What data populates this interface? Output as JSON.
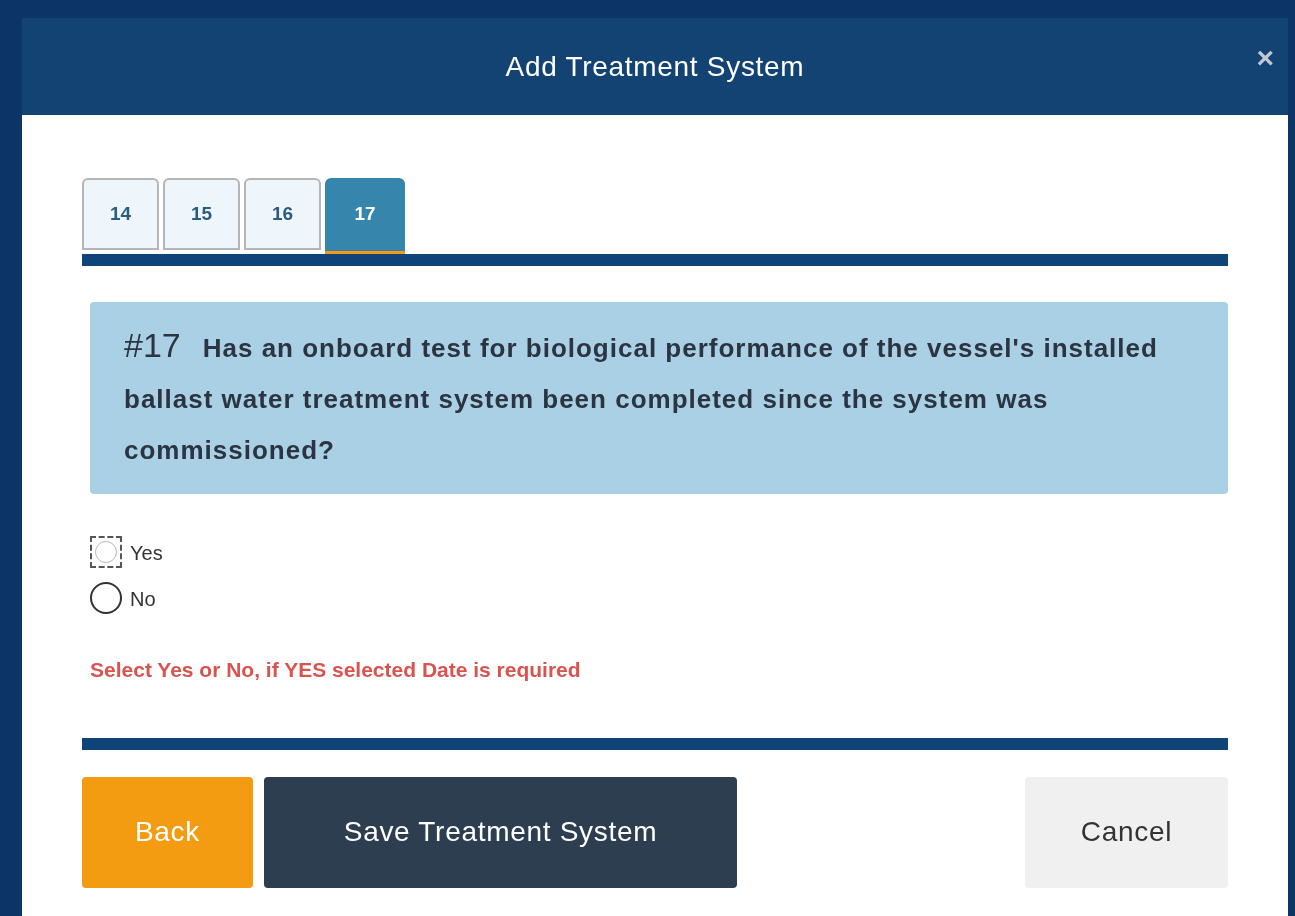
{
  "dialog": {
    "title": "Add Treatment System",
    "close": "×"
  },
  "tabs": [
    {
      "label": "14",
      "selected": false
    },
    {
      "label": "15",
      "selected": false
    },
    {
      "label": "16",
      "selected": false
    },
    {
      "label": "17",
      "selected": true
    }
  ],
  "question": {
    "number": "#17",
    "text": "Has an onboard test for biological performance of the vessel's installed ballast water treatment system been completed since the system was commissioned?"
  },
  "options": [
    {
      "label": "Yes",
      "selected": false,
      "focused": true
    },
    {
      "label": "No",
      "selected": false,
      "focused": false
    }
  ],
  "error": "Select Yes or No, if YES selected Date is required",
  "buttons": [
    {
      "label": "Back",
      "kind": "back"
    },
    {
      "label": "Save Treatment System",
      "kind": "primary"
    },
    {
      "label": "Cancel",
      "kind": "cancel"
    }
  ]
}
